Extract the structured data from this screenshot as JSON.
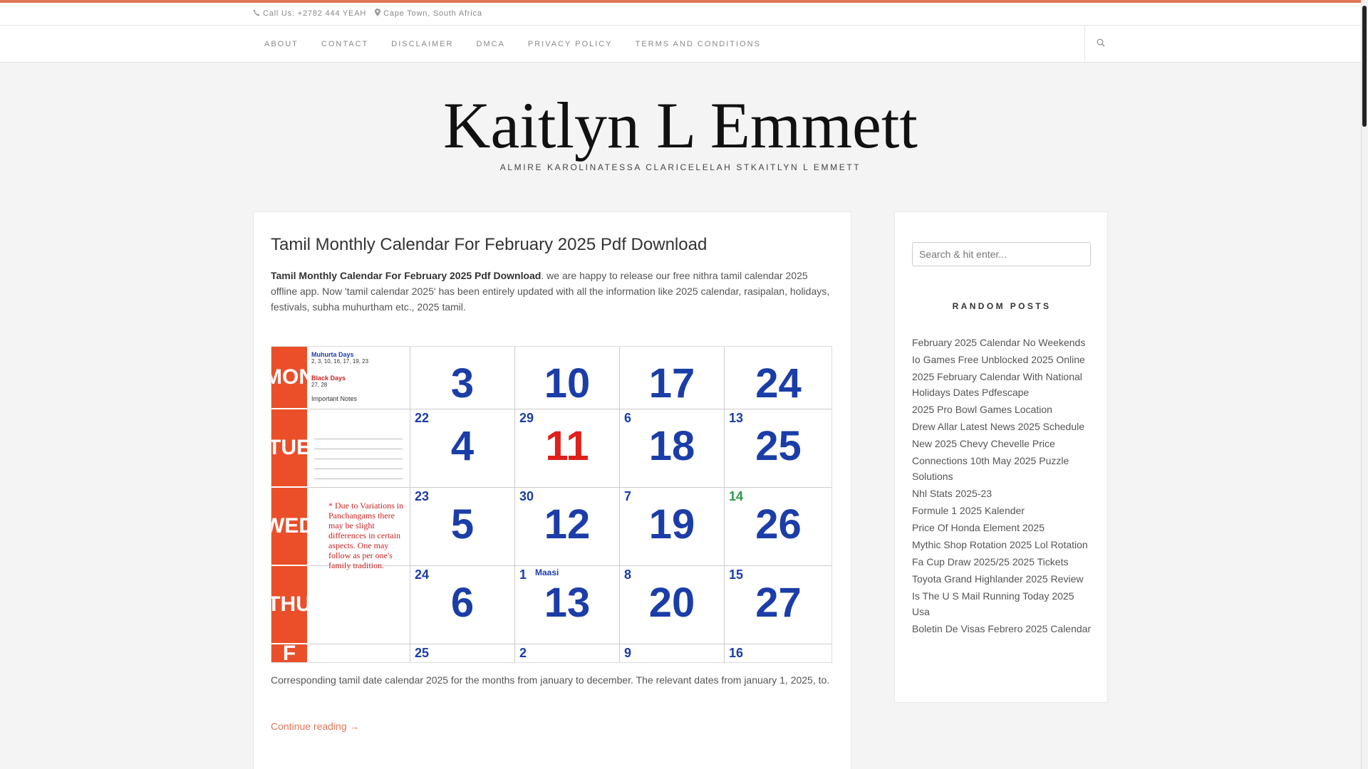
{
  "topbar": {
    "phone": "Call Us: +2782 444 YEAH",
    "location": "Cape Town, South Africa"
  },
  "nav": {
    "items": [
      "ABOUT",
      "CONTACT",
      "DISCLAIMER",
      "DMCA",
      "PRIVACY POLICY",
      "TERMS AND CONDITIONS"
    ]
  },
  "header": {
    "title": "Kaitlyn L Emmett",
    "description": "ALMIRE KAROLINATESSA CLARICELELAH STKAITLYN L EMMETT"
  },
  "post": {
    "title": "Tamil Monthly Calendar For February 2025 Pdf Download",
    "excerpt_bold": "Tamil Monthly Calendar For February 2025 Pdf Download",
    "excerpt_rest": ". we are happy to release our free nithra tamil calendar 2025 offline app. Now 'tamil calendar 2025' has been entirely updated with all the information like 2025 calendar, rasipalan, holidays, festivals, subha muhurtham etc., 2025 tamil.",
    "caption": "Corresponding tamil date calendar 2025 for the months from january to december. The relevant dates from january 1, 2025, to.",
    "continue": "Continue reading →"
  },
  "calendar_image": {
    "day_bands": [
      "MON",
      "TUE",
      "WED",
      "THU",
      "F"
    ],
    "header_left": {
      "muhurta": "Muhurta Days",
      "muhurta_dates": "2, 3, 10, 16, 17, 19, 23",
      "black_days": "Black Days",
      "black_dates": "27, 28",
      "important": "Important Notes"
    },
    "variation_note": "* Due to Variations in Panchangams there may be slight differences in certain aspects. One may follow as per one's family tradition.",
    "rows": [
      [
        {
          "big": "3"
        },
        {
          "big": "10"
        },
        {
          "big": "17"
        },
        {
          "big": "24"
        }
      ],
      [
        {
          "small": "22",
          "big": "4"
        },
        {
          "small": "29",
          "big": "11",
          "red": true
        },
        {
          "small": "6",
          "big": "18"
        },
        {
          "small": "13",
          "big": "25"
        }
      ],
      [
        {
          "small": "23",
          "big": "5"
        },
        {
          "small": "30",
          "big": "12"
        },
        {
          "small": "7",
          "big": "19"
        },
        {
          "small": "14",
          "big": "26"
        }
      ],
      [
        {
          "small": "24",
          "big": "6"
        },
        {
          "small": "1",
          "tamil": "Maasi",
          "big": "13"
        },
        {
          "small": "8",
          "big": "20"
        },
        {
          "small": "15",
          "big": "27"
        }
      ],
      [
        {
          "small": "25"
        },
        {
          "small": "2"
        },
        {
          "small": "9"
        },
        {
          "small": "16"
        }
      ]
    ]
  },
  "sidebar": {
    "search_placeholder": "Search & hit enter...",
    "heading": "RANDOM POSTS",
    "posts": [
      "February 2025 Calendar No Weekends",
      "Io Games Free Unblocked 2025 Online",
      "2025 February Calendar With National Holidays Dates Pdfescape",
      "2025 Pro Bowl Games Location",
      "Drew Allar Latest News 2025 Schedule",
      "New 2025 Chevy Chevelle Price",
      "Connections 10th May 2025 Puzzle Solutions",
      "Nhl Stats 2025-23",
      "Formule 1 2025 Kalender",
      "Price Of Honda Element 2025",
      "Mythic Shop Rotation 2025 Lol Rotation",
      "Fa Cup Draw 2025/25 2025 Tickets",
      "Toyota Grand Highlander 2025 Review",
      "Is The U S Mail Running Today 2025 Usa",
      "Boletin De Visas Febrero 2025 Calendar"
    ]
  },
  "colors": {
    "accent": "#e27659",
    "calendar_band": "#ea4f2a",
    "calendar_number": "#1b3da8"
  }
}
